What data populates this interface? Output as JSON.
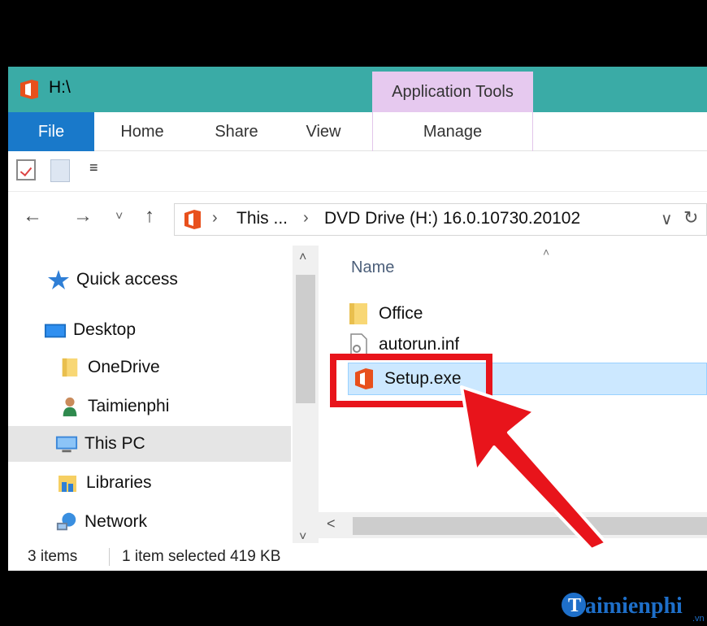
{
  "window": {
    "title": "H:\\",
    "contextual_tab_group": "Application Tools"
  },
  "ribbon": {
    "tabs": [
      {
        "label": "File"
      },
      {
        "label": "Home"
      },
      {
        "label": "Share"
      },
      {
        "label": "View"
      },
      {
        "label": "Manage"
      }
    ]
  },
  "quick_access_toolbar": {
    "dropdown_glyph": "≡",
    "icons": [
      "properties-icon",
      "new-folder-icon"
    ]
  },
  "address_bar": {
    "segment1": "This ...",
    "segment2": "DVD Drive (H:) 16.0.10730.20102",
    "separator": "›",
    "dropdown_glyph": "∨",
    "refresh_glyph": "↻"
  },
  "navigation": {
    "back_glyph": "←",
    "forward_glyph": "→",
    "recent_glyph": "˅",
    "up_glyph": "↑",
    "items": [
      {
        "label": "Quick access",
        "icon": "star-icon"
      },
      {
        "label": "Desktop",
        "icon": "desktop-icon"
      },
      {
        "label": "OneDrive",
        "icon": "folder-icon"
      },
      {
        "label": "Taimienphi",
        "icon": "user-icon"
      },
      {
        "label": "This PC",
        "icon": "computer-icon",
        "selected": true
      },
      {
        "label": "Libraries",
        "icon": "libraries-icon"
      },
      {
        "label": "Network",
        "icon": "network-icon"
      }
    ]
  },
  "scroll": {
    "up_glyph": "˄",
    "down_glyph": "˅",
    "left_glyph": "˂"
  },
  "content": {
    "sort_indicator": "˄",
    "column_name": "Name",
    "files": [
      {
        "name": "Office",
        "icon": "folder-icon"
      },
      {
        "name": "autorun.inf",
        "icon": "settings-file-icon"
      },
      {
        "name": "Setup.exe",
        "icon": "office-icon",
        "selected": true
      }
    ]
  },
  "status_bar": {
    "item_count": "3 items",
    "selection": "1 item selected  419 KB"
  },
  "colors": {
    "titlebar": "#3aaba6",
    "file_tab": "#1979ca",
    "contextual_tab": "#e6c9ef",
    "selection": "#cce8ff",
    "annotation": "#e8141b",
    "office_orange": "#e8501c"
  },
  "watermark": {
    "text": "aimienphi",
    "suffix": ".vn"
  }
}
